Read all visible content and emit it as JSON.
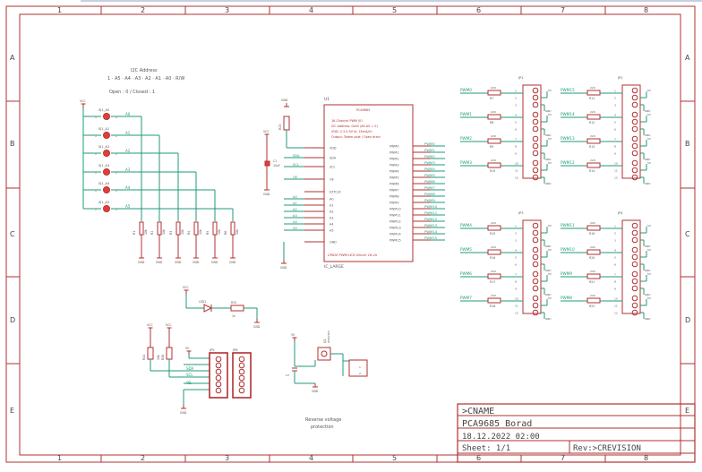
{
  "frame": {
    "columns": [
      "1",
      "2",
      "3",
      "4",
      "5",
      "6",
      "7",
      "8"
    ],
    "rows": [
      "A",
      "B",
      "C",
      "D",
      "E"
    ]
  },
  "title_block": {
    "name": ">CNAME",
    "board": "PCA9685 Borad",
    "date": "18.12.2022 02:00",
    "sheet": "Sheet: 1/1",
    "revision": "Rev:>CREVISION"
  },
  "address_header": {
    "title": "I2C Address",
    "bits": "1 · A5 · A4 · A3 · A2 · A1 · A0 · R/W",
    "legend": "Open : 0 / Closed : 1"
  },
  "jumpers": [
    {
      "name": "SJ1_A0",
      "net": "A0"
    },
    {
      "name": "SJ1_A1",
      "net": "A1"
    },
    {
      "name": "SJ1_A2",
      "net": "A2"
    },
    {
      "name": "SJ1_A3",
      "net": "A3"
    },
    {
      "name": "SJ1_A4",
      "net": "A4"
    },
    {
      "name": "SJ1_A5",
      "net": "A5"
    }
  ],
  "pulldowns": [
    "R1",
    "R2",
    "R3",
    "R4",
    "R5",
    "R6"
  ],
  "ic": {
    "ref": "U1",
    "header": [
      "PCA9685",
      "16-Channel PWM I/O",
      "I2C Address: 0x40 (A5-A0 = 0)",
      "VDD: 2.3-5.5V    Io: 25mA/ch",
      "Output: Totem pole / Open drain"
    ],
    "value": "PCA9685",
    "footer": "CMOS PWM LED Driver 16-ch",
    "left_pins": [
      "VDD",
      "SDA",
      "SCL",
      "OE",
      "EXTCLK",
      "A0",
      "A1",
      "A2",
      "A3",
      "A4",
      "A5",
      "GND"
    ],
    "right_pins": [
      "PWM0",
      "PWM1",
      "PWM2",
      "PWM3",
      "PWM4",
      "PWM5",
      "PWM6",
      "PWM7",
      "PWM8",
      "PWM9",
      "PWM10",
      "PWM11",
      "PWM12",
      "PWM13",
      "PWM14",
      "PWM15"
    ],
    "right_nets": [
      "PWM0",
      "PWM1",
      "PWM2",
      "PWM3",
      "PWM4",
      "PWM5",
      "PWM6",
      "PWM7",
      "PWM8",
      "PWM9",
      "PWM10",
      "PWM11",
      "PWM12",
      "PWM13",
      "PWM14",
      "PWM15"
    ],
    "left_nets": [
      "SDA",
      "SCL",
      "OE",
      "A0",
      "A1",
      "A2",
      "A3",
      "A4",
      "A5"
    ]
  },
  "nets": {
    "vcc": "VCC",
    "gnd": "GND",
    "v5": "5V",
    "sda": "SDA",
    "scl": "SCL",
    "oe": "OE"
  },
  "headers": [
    {
      "ref": "JP1",
      "channels": [
        "PWM0",
        "PWM1",
        "PWM2",
        "PWM3"
      ],
      "resistors": [
        "R7",
        "R8",
        "R9",
        "R10"
      ],
      "value": "220"
    },
    {
      "ref": "JP2",
      "channels": [
        "PWM15",
        "PWM14",
        "PWM13",
        "PWM12"
      ],
      "resistors": [
        "R11",
        "R12",
        "R13",
        "R14"
      ],
      "value": "220"
    },
    {
      "ref": "JP3",
      "channels": [
        "PWM4",
        "PWM5",
        "PWM6",
        "PWM7"
      ],
      "resistors": [
        "R15",
        "R16",
        "R17",
        "R18"
      ],
      "value": "220"
    },
    {
      "ref": "JP4",
      "channels": [
        "PWM11",
        "PWM10",
        "PWM9",
        "PWM8"
      ],
      "resistors": [
        "R19",
        "R20",
        "R21",
        "R22"
      ],
      "value": "220"
    }
  ],
  "connector_pins": [
    "1",
    "2",
    "3",
    "4",
    "5",
    "6",
    "7",
    "8",
    "9",
    "10",
    "11",
    "12"
  ],
  "i2c_headers": {
    "left": "JP5",
    "right": "JP6"
  },
  "led": {
    "ref": "LED1",
    "resistor": "R25",
    "value": "1k"
  },
  "caption": [
    "Reverse voltage",
    "protection"
  ],
  "ic_label": "IC_LARGE"
}
